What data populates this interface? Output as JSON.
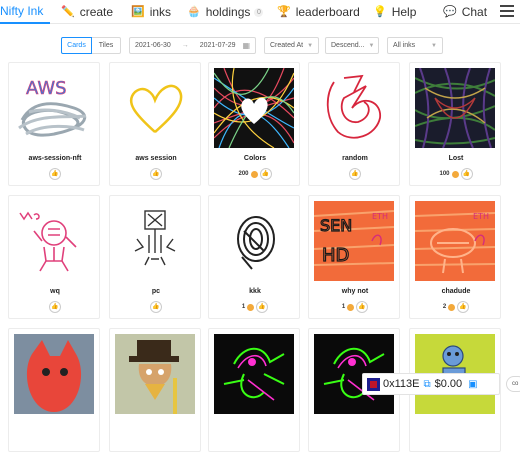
{
  "nav": {
    "brand": "Nifty Ink",
    "items": [
      {
        "label": "create",
        "icon": "pencil-icon"
      },
      {
        "label": "inks",
        "icon": "picture-icon"
      },
      {
        "label": "holdings",
        "icon": "cake-icon",
        "badge": "0"
      },
      {
        "label": "leaderboard",
        "icon": "trophy-icon"
      },
      {
        "label": "Help",
        "icon": "bulb-icon"
      },
      {
        "label": "Chat",
        "icon": "chat-icon"
      }
    ]
  },
  "filters": {
    "view_options": [
      "Cards",
      "Tiles"
    ],
    "selected_view": "Cards",
    "date_start": "2021-06-30",
    "date_sep": "→",
    "date_end": "2021-07-29",
    "sort_by": "Created At",
    "order": "Descend...",
    "ink_filter": "All inks"
  },
  "cards": [
    {
      "name": "aws-session-nft",
      "price": "",
      "art": "aws"
    },
    {
      "name": "aws session",
      "price": "",
      "art": "heart-yellow"
    },
    {
      "name": "Colors",
      "price": "200",
      "art": "colors"
    },
    {
      "name": "random",
      "price": "",
      "art": "random"
    },
    {
      "name": "Lost",
      "price": "100",
      "art": "lost"
    },
    {
      "name": "wq",
      "price": "",
      "art": "wq"
    },
    {
      "name": "pc",
      "price": "",
      "art": "pc"
    },
    {
      "name": "kkk",
      "price": "1",
      "art": "kkk"
    },
    {
      "name": "why not",
      "price": "1",
      "art": "whynot"
    },
    {
      "name": "chadude",
      "price": "2",
      "art": "chadude"
    },
    {
      "name": "",
      "price": "",
      "art": "red-monster"
    },
    {
      "name": "",
      "price": "",
      "art": "hat-man"
    },
    {
      "name": "",
      "price": "",
      "art": "neon-1"
    },
    {
      "name": "",
      "price": "",
      "art": "neon-2"
    },
    {
      "name": "",
      "price": "",
      "art": "robot"
    }
  ],
  "wallet": {
    "address": "0x113E",
    "balance": "$0.00",
    "edge_button": "co"
  },
  "colors": {
    "accent": "#1890ff",
    "coin": "#f3a93b"
  }
}
